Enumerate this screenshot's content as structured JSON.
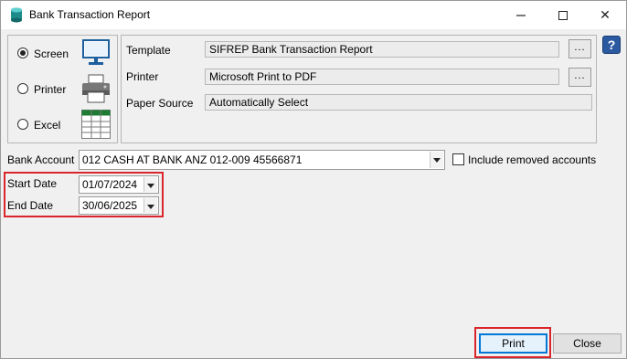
{
  "window": {
    "title": "Bank Transaction Report",
    "minimize_icon": "minimize-icon",
    "maximize_icon": "maximize-icon",
    "close_glyph": "✕"
  },
  "output": {
    "options": [
      {
        "label": "Screen",
        "checked": true,
        "icon": "monitor-icon"
      },
      {
        "label": "Printer",
        "checked": false,
        "icon": "printer-icon"
      },
      {
        "label": "Excel",
        "checked": false,
        "icon": "spreadsheet-icon"
      }
    ]
  },
  "settings": {
    "template_label": "Template",
    "template_value": "SIFREP Bank Transaction Report",
    "printer_label": "Printer",
    "printer_value": "Microsoft Print to PDF",
    "paper_source_label": "Paper Source",
    "paper_source_value": "Automatically Select",
    "browse_label": "..."
  },
  "help_label": "?",
  "bank_account": {
    "label": "Bank Account",
    "value": "012  CASH AT BANK  ANZ  012-009  45566871",
    "include_removed_label": "Include removed accounts",
    "include_removed_checked": false
  },
  "dates": {
    "start_label": "Start Date",
    "start_value": "01/07/2024",
    "end_label": "End Date",
    "end_value": "30/06/2025"
  },
  "buttons": {
    "print": "Print",
    "close": "Close"
  },
  "colors": {
    "highlight": "#d9262c",
    "accent": "#0078d7",
    "excel_green": "#1e7b34"
  }
}
